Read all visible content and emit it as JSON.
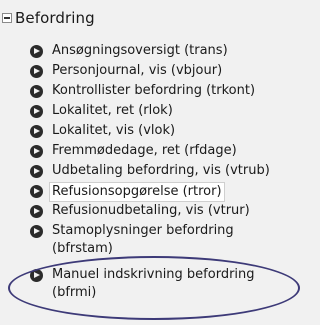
{
  "section": {
    "title": "Befordring",
    "expanded": true,
    "collapse_icon": "minus-box-icon"
  },
  "items": [
    {
      "label": "Ansøgningsoversigt (trans)"
    },
    {
      "label": "Personjournal, vis (vbjour)"
    },
    {
      "label": "Kontrollister befordring (trkont)"
    },
    {
      "label": "Lokalitet, ret (rlok)"
    },
    {
      "label": "Lokalitet, vis (vlok)"
    },
    {
      "label": "Fremmødedage, ret (rfdage)"
    },
    {
      "label": "Udbetaling befordring, vis (vtrub)"
    },
    {
      "label": "Refusionsopgørelse (rtror)",
      "highlighted": true
    },
    {
      "label": "Refusionudbetaling, vis (vtrur)"
    },
    {
      "label": "Stamoplysninger befordring (bfrstam)"
    },
    {
      "label": "Manuel indskrivning befordring (bfrmi)",
      "annotated": true
    }
  ],
  "bullet_icon": "arrow-circle-icon",
  "colors": {
    "background": "#f1f1f1",
    "bullet": "#2b2b2b",
    "annotation": "#3d3a78"
  }
}
